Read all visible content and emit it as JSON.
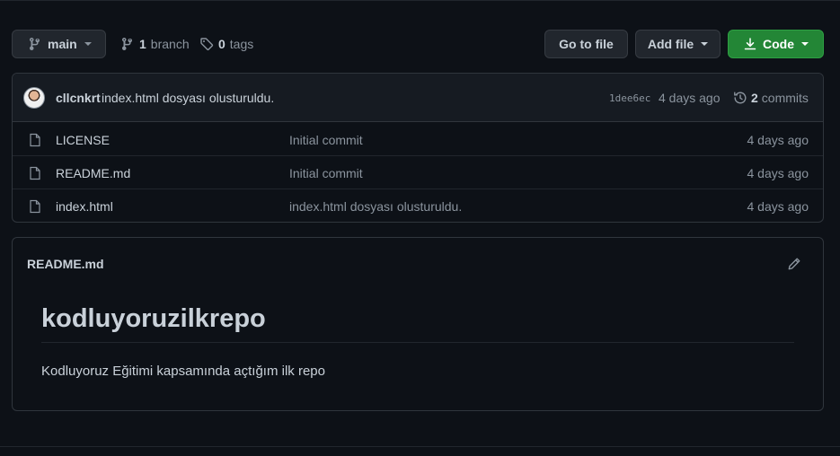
{
  "toolbar": {
    "branch_name": "main",
    "branch_count": "1",
    "branch_label": "branch",
    "tag_count": "0",
    "tag_label": "tags",
    "goto_file_label": "Go to file",
    "add_file_label": "Add file",
    "code_label": "Code",
    "code_button_color": "#238636"
  },
  "commit": {
    "author": "cllcnkrt",
    "message": "index.html dosyası olusturuldu.",
    "sha": "1dee6ec",
    "time": "4 days ago",
    "commit_count": "2",
    "commit_label": "commits"
  },
  "files": [
    {
      "name": "LICENSE",
      "message": "Initial commit",
      "age": "4 days ago",
      "icon": "file-icon"
    },
    {
      "name": "README.md",
      "message": "Initial commit",
      "age": "4 days ago",
      "icon": "file-icon"
    },
    {
      "name": "index.html",
      "message": "index.html dosyası olusturuldu.",
      "age": "4 days ago",
      "icon": "file-icon"
    }
  ],
  "readme": {
    "filename": "README.md",
    "heading": "kodluyoruzilkrepo",
    "body": "Kodluyoruz Eğitimi kapsamında açtığım ilk repo"
  }
}
